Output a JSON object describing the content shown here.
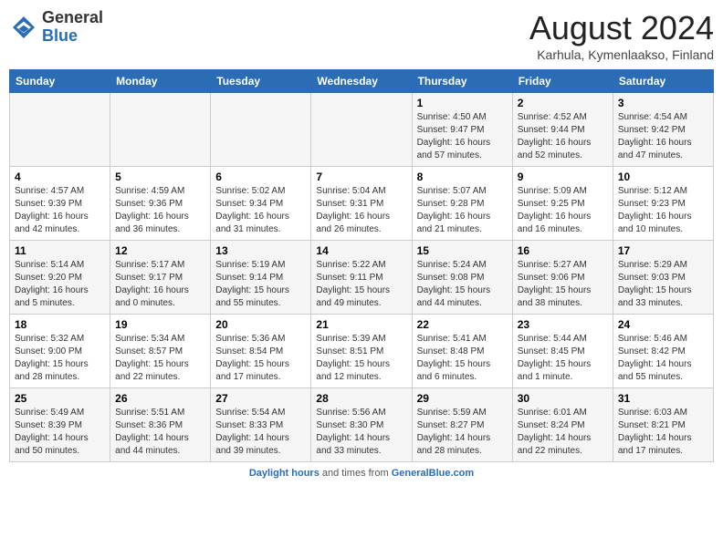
{
  "header": {
    "logo_general": "General",
    "logo_blue": "Blue",
    "title": "August 2024",
    "subtitle": "Karhula, Kymenlaakso, Finland"
  },
  "weekdays": [
    "Sunday",
    "Monday",
    "Tuesday",
    "Wednesday",
    "Thursday",
    "Friday",
    "Saturday"
  ],
  "weeks": [
    [
      {
        "day": "",
        "info": ""
      },
      {
        "day": "",
        "info": ""
      },
      {
        "day": "",
        "info": ""
      },
      {
        "day": "",
        "info": ""
      },
      {
        "day": "1",
        "info": "Sunrise: 4:50 AM\nSunset: 9:47 PM\nDaylight: 16 hours and 57 minutes."
      },
      {
        "day": "2",
        "info": "Sunrise: 4:52 AM\nSunset: 9:44 PM\nDaylight: 16 hours and 52 minutes."
      },
      {
        "day": "3",
        "info": "Sunrise: 4:54 AM\nSunset: 9:42 PM\nDaylight: 16 hours and 47 minutes."
      }
    ],
    [
      {
        "day": "4",
        "info": "Sunrise: 4:57 AM\nSunset: 9:39 PM\nDaylight: 16 hours and 42 minutes."
      },
      {
        "day": "5",
        "info": "Sunrise: 4:59 AM\nSunset: 9:36 PM\nDaylight: 16 hours and 36 minutes."
      },
      {
        "day": "6",
        "info": "Sunrise: 5:02 AM\nSunset: 9:34 PM\nDaylight: 16 hours and 31 minutes."
      },
      {
        "day": "7",
        "info": "Sunrise: 5:04 AM\nSunset: 9:31 PM\nDaylight: 16 hours and 26 minutes."
      },
      {
        "day": "8",
        "info": "Sunrise: 5:07 AM\nSunset: 9:28 PM\nDaylight: 16 hours and 21 minutes."
      },
      {
        "day": "9",
        "info": "Sunrise: 5:09 AM\nSunset: 9:25 PM\nDaylight: 16 hours and 16 minutes."
      },
      {
        "day": "10",
        "info": "Sunrise: 5:12 AM\nSunset: 9:23 PM\nDaylight: 16 hours and 10 minutes."
      }
    ],
    [
      {
        "day": "11",
        "info": "Sunrise: 5:14 AM\nSunset: 9:20 PM\nDaylight: 16 hours and 5 minutes."
      },
      {
        "day": "12",
        "info": "Sunrise: 5:17 AM\nSunset: 9:17 PM\nDaylight: 16 hours and 0 minutes."
      },
      {
        "day": "13",
        "info": "Sunrise: 5:19 AM\nSunset: 9:14 PM\nDaylight: 15 hours and 55 minutes."
      },
      {
        "day": "14",
        "info": "Sunrise: 5:22 AM\nSunset: 9:11 PM\nDaylight: 15 hours and 49 minutes."
      },
      {
        "day": "15",
        "info": "Sunrise: 5:24 AM\nSunset: 9:08 PM\nDaylight: 15 hours and 44 minutes."
      },
      {
        "day": "16",
        "info": "Sunrise: 5:27 AM\nSunset: 9:06 PM\nDaylight: 15 hours and 38 minutes."
      },
      {
        "day": "17",
        "info": "Sunrise: 5:29 AM\nSunset: 9:03 PM\nDaylight: 15 hours and 33 minutes."
      }
    ],
    [
      {
        "day": "18",
        "info": "Sunrise: 5:32 AM\nSunset: 9:00 PM\nDaylight: 15 hours and 28 minutes."
      },
      {
        "day": "19",
        "info": "Sunrise: 5:34 AM\nSunset: 8:57 PM\nDaylight: 15 hours and 22 minutes."
      },
      {
        "day": "20",
        "info": "Sunrise: 5:36 AM\nSunset: 8:54 PM\nDaylight: 15 hours and 17 minutes."
      },
      {
        "day": "21",
        "info": "Sunrise: 5:39 AM\nSunset: 8:51 PM\nDaylight: 15 hours and 12 minutes."
      },
      {
        "day": "22",
        "info": "Sunrise: 5:41 AM\nSunset: 8:48 PM\nDaylight: 15 hours and 6 minutes."
      },
      {
        "day": "23",
        "info": "Sunrise: 5:44 AM\nSunset: 8:45 PM\nDaylight: 15 hours and 1 minute."
      },
      {
        "day": "24",
        "info": "Sunrise: 5:46 AM\nSunset: 8:42 PM\nDaylight: 14 hours and 55 minutes."
      }
    ],
    [
      {
        "day": "25",
        "info": "Sunrise: 5:49 AM\nSunset: 8:39 PM\nDaylight: 14 hours and 50 minutes."
      },
      {
        "day": "26",
        "info": "Sunrise: 5:51 AM\nSunset: 8:36 PM\nDaylight: 14 hours and 44 minutes."
      },
      {
        "day": "27",
        "info": "Sunrise: 5:54 AM\nSunset: 8:33 PM\nDaylight: 14 hours and 39 minutes."
      },
      {
        "day": "28",
        "info": "Sunrise: 5:56 AM\nSunset: 8:30 PM\nDaylight: 14 hours and 33 minutes."
      },
      {
        "day": "29",
        "info": "Sunrise: 5:59 AM\nSunset: 8:27 PM\nDaylight: 14 hours and 28 minutes."
      },
      {
        "day": "30",
        "info": "Sunrise: 6:01 AM\nSunset: 8:24 PM\nDaylight: 14 hours and 22 minutes."
      },
      {
        "day": "31",
        "info": "Sunrise: 6:03 AM\nSunset: 8:21 PM\nDaylight: 14 hours and 17 minutes."
      }
    ]
  ],
  "footer": {
    "text": "Daylight hours",
    "source": "GeneralBlue.com"
  }
}
